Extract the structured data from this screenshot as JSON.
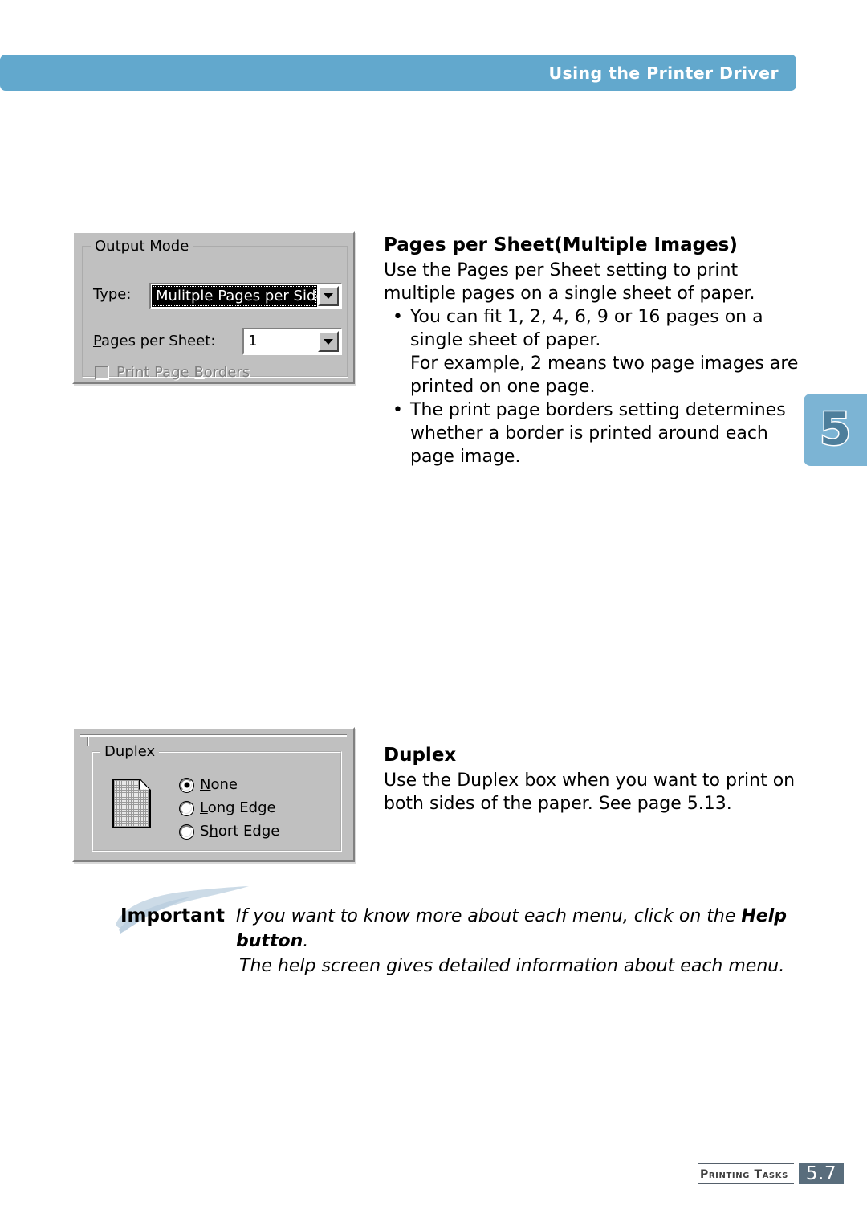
{
  "header": {
    "title": "Using the Printer Driver",
    "accent_color": "#62a8cd"
  },
  "chapter_tab": {
    "number": "5",
    "background_color": "#7cb4d4",
    "number_color": "#4d7e9b"
  },
  "output_mode_dialog": {
    "group_title": "Output Mode",
    "type_label": "Type:",
    "type_label_mnemonic": "T",
    "type_value": "Mulitple Pages per Sides",
    "type_state": "selected",
    "pages_per_sheet_label": "Pages per Sheet:",
    "pages_per_sheet_mnemonic": "P",
    "pages_per_sheet_value": "1",
    "print_page_borders_label": "Print Page Borders",
    "print_page_borders_mnemonic": "B",
    "print_page_borders_checked": false,
    "print_page_borders_enabled": false
  },
  "duplex_dialog": {
    "group_title": "Duplex",
    "options": [
      {
        "label_pre": "",
        "label_mnemonic": "N",
        "label_post": "one",
        "checked": true
      },
      {
        "label_pre": "",
        "label_mnemonic": "L",
        "label_post": "ong Edge",
        "checked": false
      },
      {
        "label_pre": "S",
        "label_mnemonic": "h",
        "label_post": "ort Edge",
        "checked": false
      }
    ],
    "icon": "page-sheet-icon"
  },
  "sections": [
    {
      "heading": "Pages per Sheet(Multiple Images)",
      "intro_line_1": "Use the Pages per Sheet setting to print",
      "intro_line_2": "multiple pages on a single sheet of paper.",
      "bullets": [
        {
          "text": "You can fit 1, 2, 4, 6, 9 or 16 pages on a single sheet of paper.",
          "sub": "For example, 2 means two page images are printed on one page."
        },
        {
          "text": "The print page borders setting determines whether a border is printed around each page image.",
          "sub": ""
        }
      ]
    },
    {
      "heading": "Duplex",
      "intro_line_1": "Use the Duplex box when you want to print on",
      "intro_line_2": "both sides of the paper. See page 5.13.",
      "bullets": []
    }
  ],
  "important_note": {
    "label": "Important",
    "line1_before": "If you want to know more about each menu, click on the ",
    "line1_bold": "Help button",
    "line1_after": ".",
    "line2": "The help screen gives detailed information about each menu."
  },
  "footer": {
    "label": "Printing Tasks",
    "page_number": "5.7",
    "page_box_color": "#596d7c"
  }
}
